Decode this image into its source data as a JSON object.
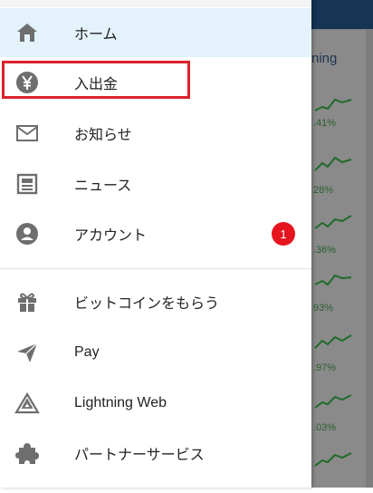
{
  "menu": {
    "items": [
      {
        "label": "ホーム",
        "icon": "home-icon"
      },
      {
        "label": "入出金",
        "icon": "yen-icon"
      },
      {
        "label": "お知らせ",
        "icon": "mail-icon"
      },
      {
        "label": "ニュース",
        "icon": "news-icon"
      },
      {
        "label": "アカウント",
        "icon": "account-icon",
        "badge": "1"
      },
      {
        "label": "ビットコインをもらう",
        "icon": "gift-icon"
      },
      {
        "label": "Pay",
        "icon": "send-icon"
      },
      {
        "label": "Lightning Web",
        "icon": "mountain-icon"
      },
      {
        "label": "パートナーサービス",
        "icon": "puzzle-icon"
      }
    ]
  },
  "background": {
    "title_fragment": "ning",
    "rows": [
      ".41%",
      "28%",
      ".36%",
      "93%",
      ".97%",
      ".03%"
    ]
  },
  "colors": {
    "active_bg": "#e3f2fb",
    "badge": "#e6141e",
    "highlight": "#d9222a",
    "icon": "#6e6e6e"
  }
}
